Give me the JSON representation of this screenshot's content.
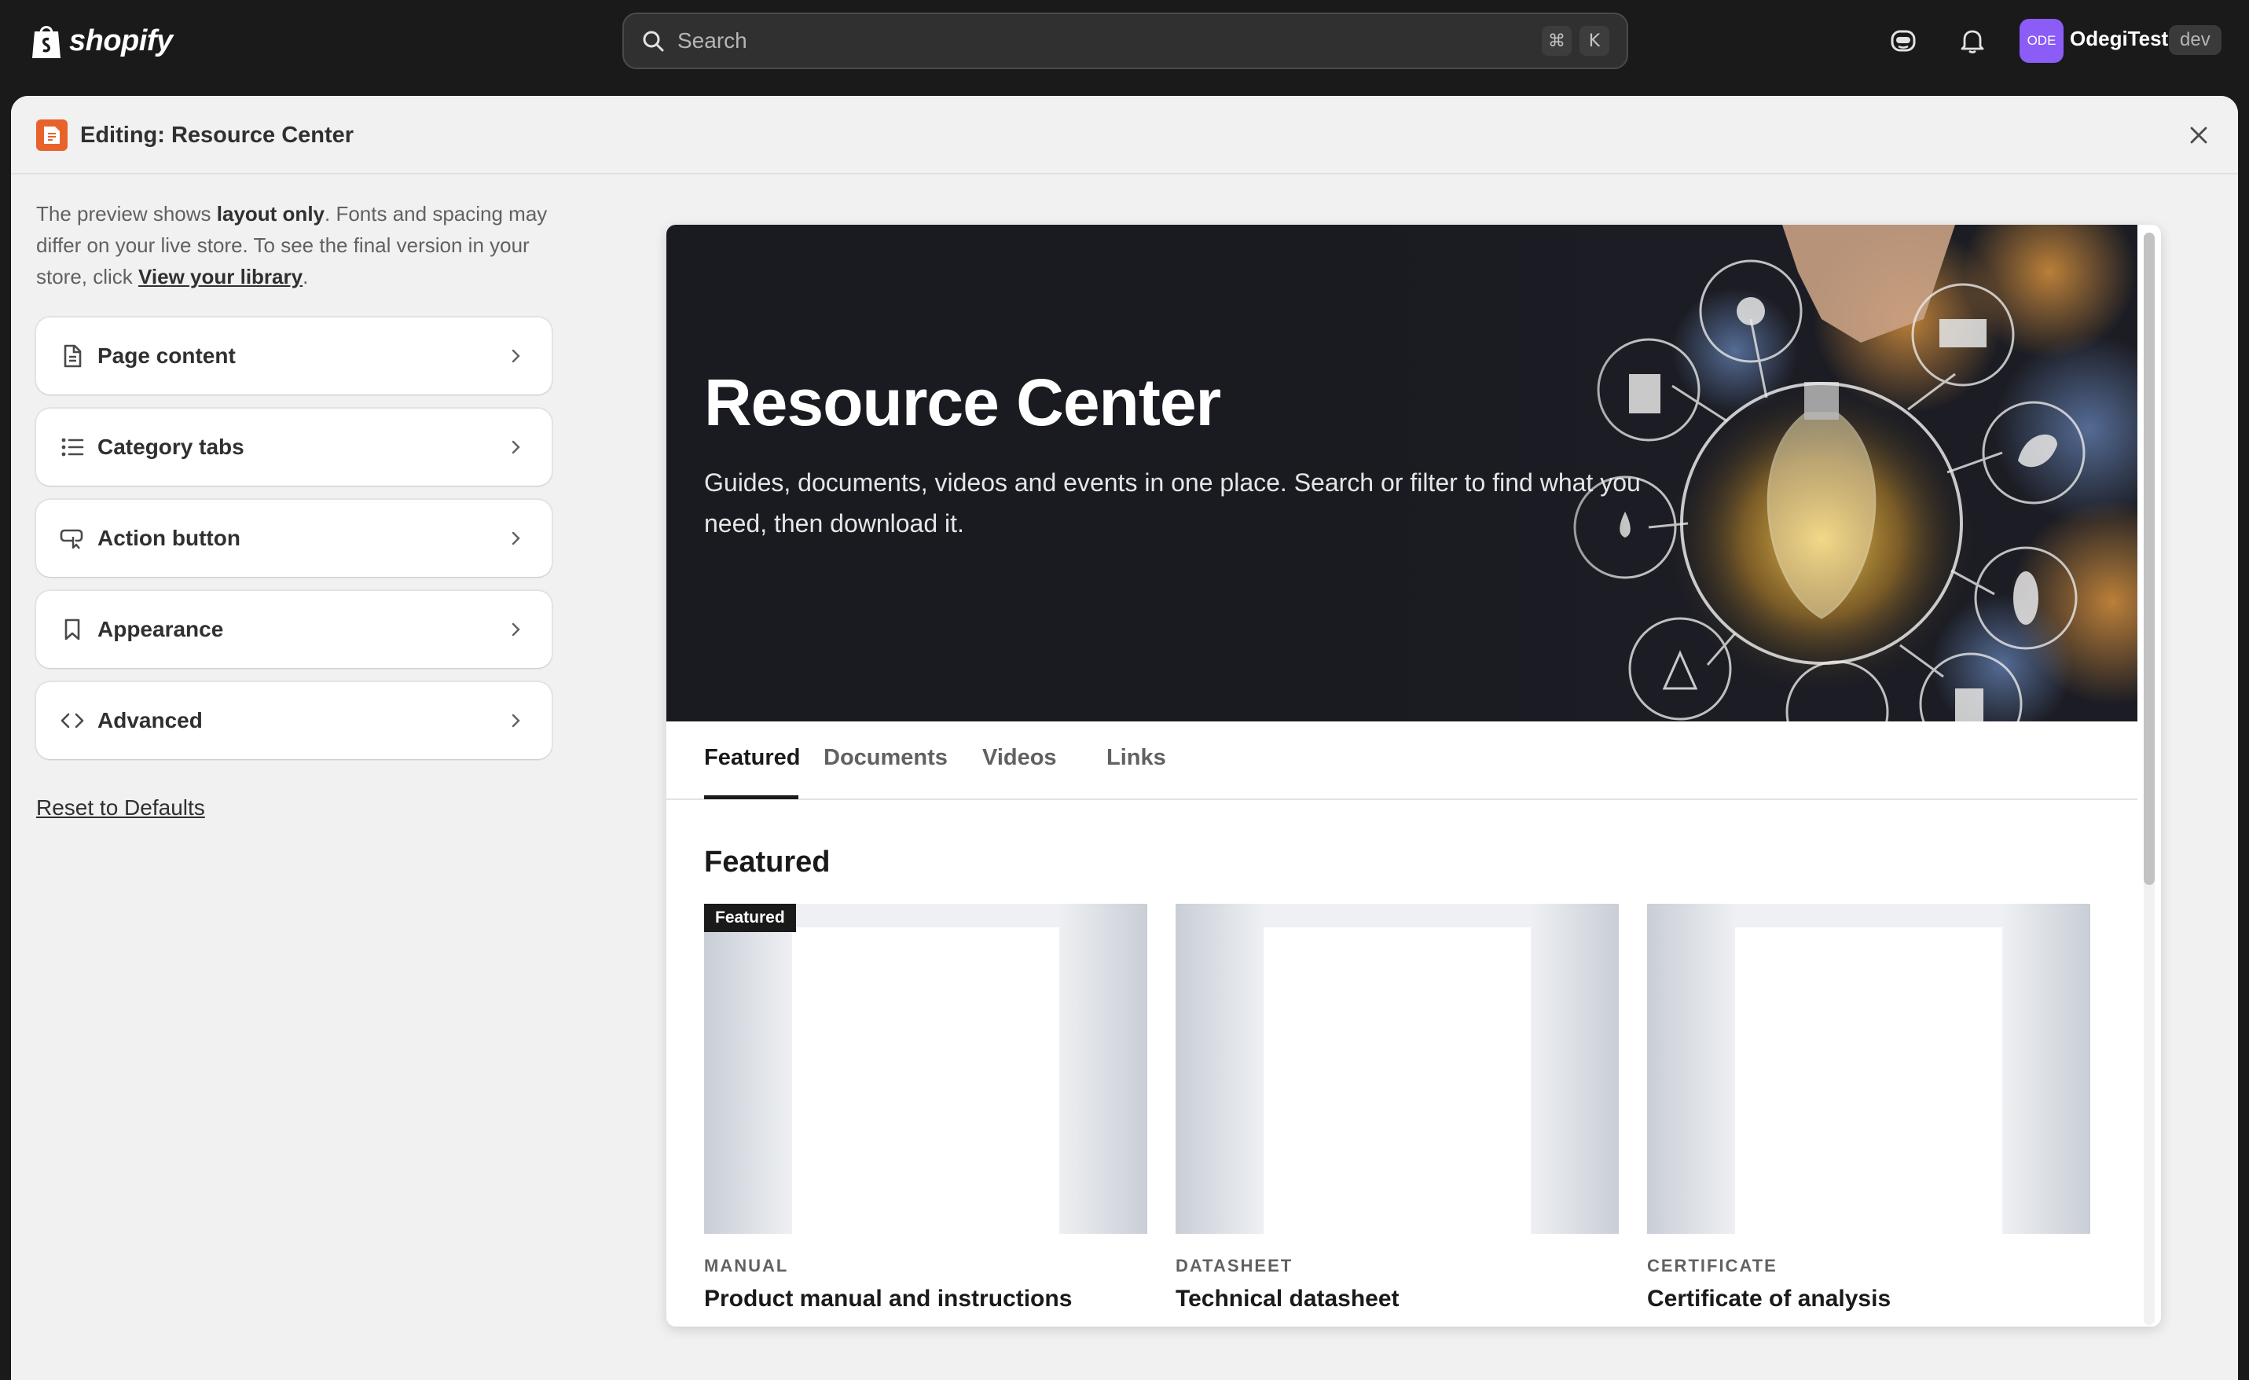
{
  "topbar": {
    "brand": "shopify",
    "search_placeholder": "Search",
    "shortcut_mod": "⌘",
    "shortcut_key": "K",
    "avatar_initials": "ODE",
    "store_name": "OdegiTest",
    "store_badge": "dev"
  },
  "modal": {
    "title": "Editing: Resource Center"
  },
  "sidebar": {
    "note_prefix": "The preview shows ",
    "note_bold": "layout only",
    "note_mid": ". Fonts and spacing may differ on your live store. To see the final version in your store, click ",
    "note_link": "View your library",
    "note_suffix": ".",
    "panels": [
      {
        "label": "Page content",
        "icon": "document-icon"
      },
      {
        "label": "Category tabs",
        "icon": "list-icon"
      },
      {
        "label": "Action button",
        "icon": "button-pointer-icon"
      },
      {
        "label": "Appearance",
        "icon": "bookmark-icon"
      },
      {
        "label": "Advanced",
        "icon": "code-icon"
      }
    ],
    "reset_label": "Reset to Defaults"
  },
  "preview": {
    "hero_title": "Resource Center",
    "hero_subtitle": "Guides, documents, videos and events in one place. Search or filter to find what you need, then download it.",
    "tabs": [
      "Featured",
      "Documents",
      "Videos",
      "Links"
    ],
    "active_tab": "Featured",
    "section_title": "Featured",
    "cards": [
      {
        "badge": "Featured",
        "category": "MANUAL",
        "title": "Product manual and instructions"
      },
      {
        "badge": "",
        "category": "DATASHEET",
        "title": "Technical datasheet"
      },
      {
        "badge": "",
        "category": "CERTIFICATE",
        "title": "Certificate of analysis"
      }
    ]
  },
  "colors": {
    "topbar": "#1a1a1a",
    "accent_app": "#e8632b",
    "avatar": "#8b5cf6",
    "hero_bg": "#191b21"
  }
}
